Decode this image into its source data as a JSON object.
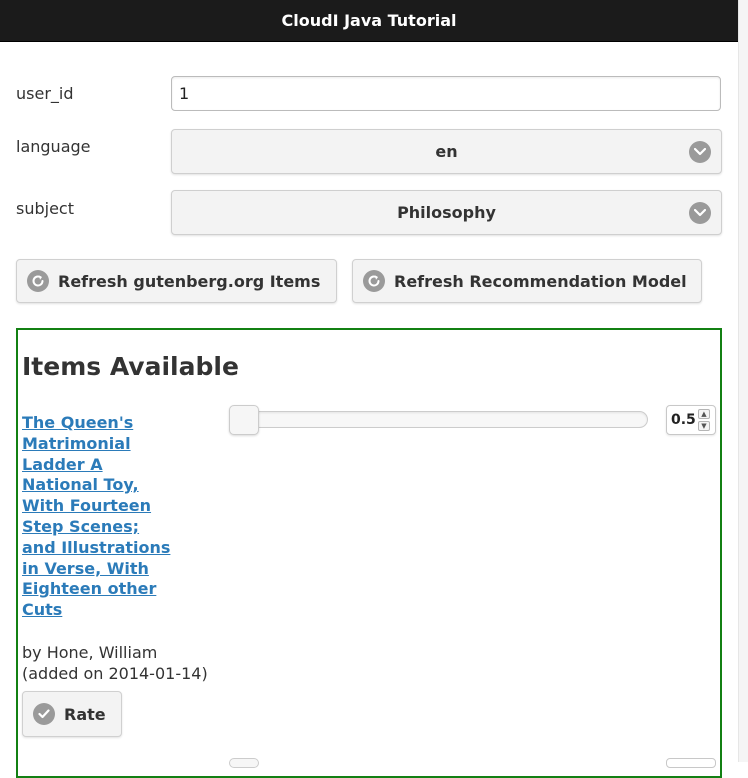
{
  "header": {
    "title": "CloudI Java Tutorial"
  },
  "form": {
    "user_id_label": "user_id",
    "user_id_value": "1",
    "language_label": "language",
    "language_value": "en",
    "subject_label": "subject",
    "subject_value": "Philosophy"
  },
  "buttons": {
    "refresh_items": "Refresh gutenberg.org Items",
    "refresh_model": "Refresh Recommendation Model"
  },
  "items": {
    "title": "Items Available",
    "list": [
      {
        "title": "The Queen's Matrimonial Ladder A National Toy, With Fourteen Step Scenes; and Illustrations in Verse, With Eighteen other Cuts",
        "author": "by Hone, William",
        "added": "(added on 2014-01-14)",
        "rating": "0.5",
        "rating_fraction": 0.0,
        "rate_label": "Rate"
      }
    ]
  },
  "icons": {
    "select_chevron": "chevron-down-icon",
    "refresh": "refresh-icon",
    "rate": "check-icon"
  },
  "colors": {
    "header_bg": "#1b1b1b",
    "link": "#2b7bb9",
    "items_border": "#138013"
  }
}
